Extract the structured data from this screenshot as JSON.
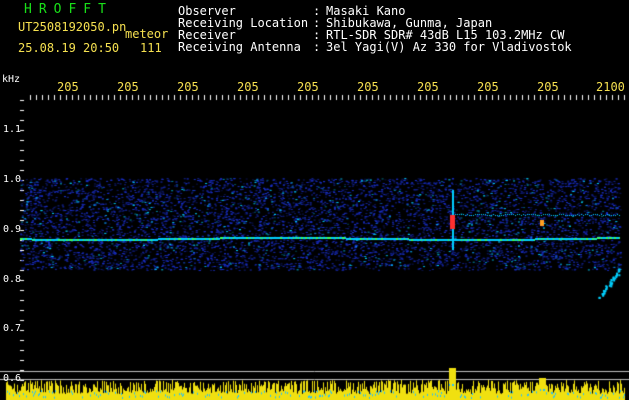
{
  "header": {
    "title": "HROFFT",
    "file_name": "UT2508192050.pn",
    "mode": "meteor",
    "datetime": "25.08.19 20:50",
    "count": "111",
    "rows": [
      {
        "label": "Observer",
        "value": "Masaki Kano"
      },
      {
        "label": "Receiving Location",
        "value": "Shibukawa, Gunma, Japan"
      },
      {
        "label": "Receiver",
        "value": "RTL-SDR SDR# 43dB L15 103.2MHz CW"
      },
      {
        "label": "Receiving Antenna",
        "value": "3el Yagi(V) Az 330 for Vladivostok"
      }
    ]
  },
  "chart_data": {
    "type": "heatmap",
    "ylabel": "kHz",
    "y_ticks": [
      "1.1",
      "1.0",
      "0.9",
      "0.8",
      "0.7",
      "0.6"
    ],
    "x_ticks": [
      "205",
      "205",
      "205",
      "205",
      "205",
      "205",
      "205",
      "205",
      "205",
      "2100"
    ],
    "ylim": [
      0.6,
      1.15
    ],
    "colors": {
      "noise": "#1a2fc8",
      "signal": "#00d0ff",
      "strong": "#ff3030",
      "histogram": "#f0e010",
      "text": "#f5e050"
    }
  }
}
